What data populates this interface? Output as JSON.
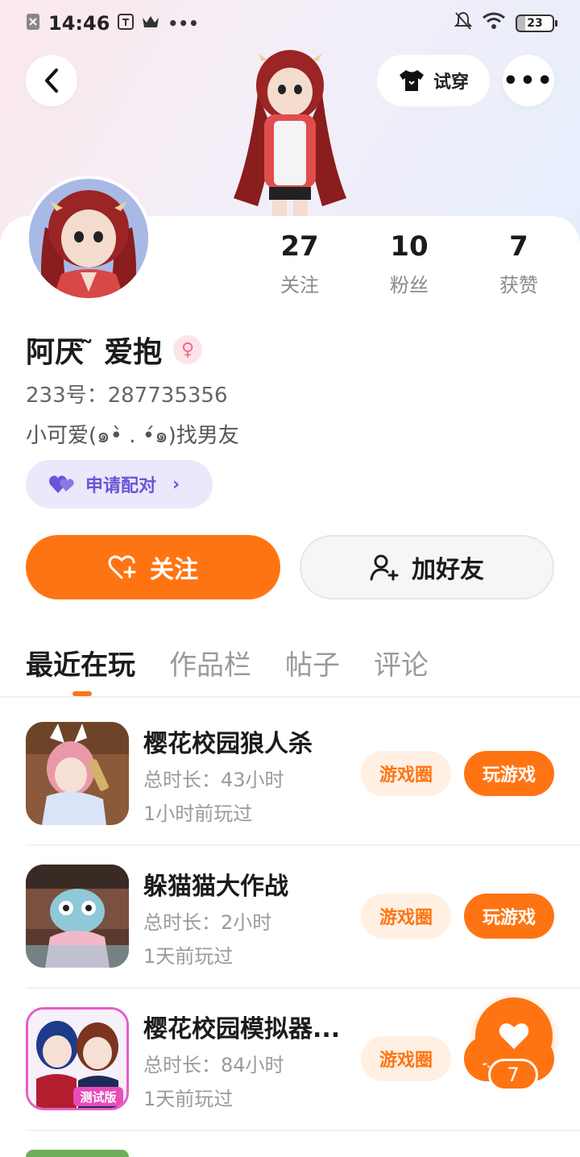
{
  "status_bar": {
    "time": "14:46",
    "battery": "23"
  },
  "header": {
    "tryon_label": "试穿"
  },
  "profile": {
    "name": "阿厌  ̃ 爱抱",
    "gender_symbol": "♀",
    "uid": "233号：287735356",
    "bio": "小可爱(๑•̀ . •́๑)找男友",
    "match_label": "申请配对"
  },
  "stats": [
    {
      "value": "27",
      "label": "关注"
    },
    {
      "value": "10",
      "label": "粉丝"
    },
    {
      "value": "7",
      "label": "获赞"
    }
  ],
  "actions": {
    "follow_label": "关注",
    "add_friend_label": "加好友"
  },
  "tabs": [
    "最近在玩",
    "作品栏",
    "帖子",
    "评论"
  ],
  "games": [
    {
      "name": "樱花校园狼人杀",
      "time": "总时长：43小时",
      "last_played": "1小时前玩过",
      "circle_label": "游戏圈",
      "play_label": "玩游戏"
    },
    {
      "name": "躲猫猫大作战",
      "time": "总时长：2小时",
      "last_played": "1天前玩过",
      "circle_label": "游戏圈",
      "play_label": "玩游戏"
    },
    {
      "name": "樱花校园模拟器...",
      "time": "总时长：84小时",
      "last_played": "1天前玩过",
      "circle_label": "游戏圈",
      "play_label": "玩游戏",
      "icon_badge": "测试版"
    }
  ],
  "like_fab": {
    "count": "7"
  },
  "colors": {
    "accent": "#ff7412",
    "match_purple": "#6b55d6"
  }
}
